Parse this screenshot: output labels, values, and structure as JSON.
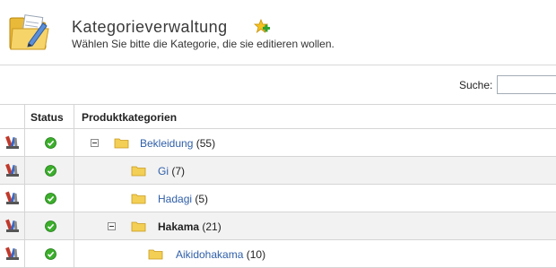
{
  "header": {
    "title": "Kategorieverwaltung",
    "subtitle": "Wählen Sie bitte die Kategorie, die sie editieren wollen."
  },
  "search": {
    "label": "Suche:",
    "value": "",
    "placeholder": ""
  },
  "table": {
    "columns": [
      "",
      "Status",
      "Produktkategorien"
    ],
    "rows": [
      {
        "name": "Bekleidung",
        "count": "(55)",
        "style": "link",
        "expanded": true,
        "status": "active"
      },
      {
        "name": "Gi",
        "count": "(7)",
        "style": "link",
        "expanded": false,
        "status": "active"
      },
      {
        "name": "Hadagi",
        "count": "(5)",
        "style": "link",
        "expanded": false,
        "status": "active"
      },
      {
        "name": "Hakama",
        "count": "(21)",
        "style": "bold",
        "expanded": true,
        "status": "active"
      },
      {
        "name": "Aikidohakama",
        "count": "(10)",
        "style": "link",
        "expanded": false,
        "status": "active"
      }
    ]
  },
  "icons": {
    "header": "folder-edit-icon",
    "add": "add-star-icon",
    "edit": "edit-tools-icon",
    "status": "check-circle-icon",
    "folder": "folder-icon",
    "toggle": "collapse-icon"
  },
  "colors": {
    "link": "#2f5fa8",
    "status_ok": "#3cae2c",
    "alt_row": "#f2f2f2",
    "folder": "#f3cf55"
  }
}
